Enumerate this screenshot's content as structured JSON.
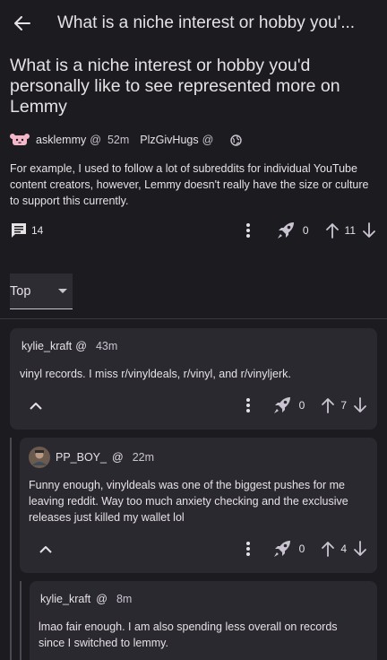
{
  "appbar": {
    "title": "What is a niche interest or hobby you'..."
  },
  "post": {
    "title": "What is a niche interest or hobby you'd personally like to see represented more on Lemmy",
    "community": "asklemmy",
    "community_at": "@",
    "time": "52m",
    "author": "PlzGivHugs",
    "author_at": "@",
    "body": "For example, I used to follow a lot of subreddits for individual YouTube content creators, however, Lemmy doesn't really have the size or culture to support this currently.",
    "comment_count": "14",
    "boosts": "0",
    "score": "11"
  },
  "sort": {
    "selected": "Top"
  },
  "comments": [
    {
      "user": "kylie_kraft",
      "at": "@",
      "time": "43m",
      "text": "vinyl records. I miss r/vinyldeals, r/vinyl, and r/vinyljerk.",
      "boosts": "0",
      "score": "7"
    },
    {
      "user": "PP_BOY_",
      "at": "@",
      "time": "22m",
      "text": "Funny enough, vinyldeals was one of the biggest pushes for me leaving reddit. Way too much anxiety checking and the exclusive releases just killed my wallet lol",
      "boosts": "0",
      "score": "4"
    },
    {
      "user": "kylie_kraft",
      "at": "@",
      "time": "8m",
      "text": "lmao fair enough. I am also spending less overall on records since I switched to lemmy."
    }
  ],
  "colors": {
    "background": "#1c1b1f",
    "card": "#2b2930",
    "text": "#e6e1e5"
  }
}
